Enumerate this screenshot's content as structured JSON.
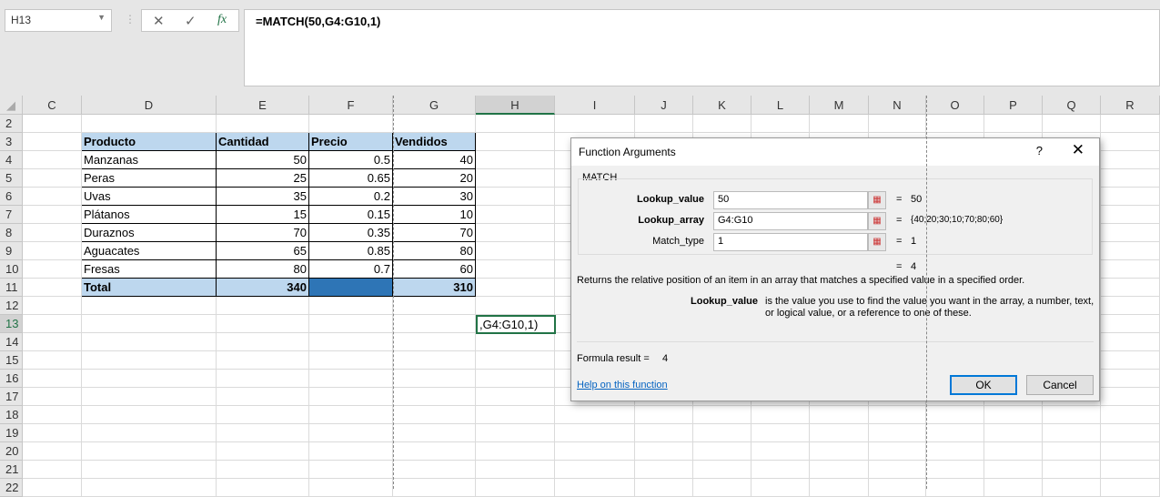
{
  "name_box": "H13",
  "formula_bar": {
    "cancel_icon": "✕",
    "enter_icon": "✓",
    "fx_icon": "fx",
    "formula": "=MATCH(50,G4:G10,1)"
  },
  "columns": [
    "C",
    "D",
    "E",
    "F",
    "G",
    "H",
    "I",
    "J",
    "K",
    "L",
    "M",
    "N",
    "O",
    "P",
    "Q",
    "R"
  ],
  "rows": [
    "2",
    "3",
    "4",
    "5",
    "6",
    "7",
    "8",
    "9",
    "10",
    "11",
    "12",
    "13",
    "14",
    "15",
    "16",
    "17",
    "18",
    "19",
    "20",
    "21",
    "22"
  ],
  "table": {
    "headers": [
      "Producto",
      "Cantidad",
      "Precio",
      "Vendidos"
    ],
    "rows": [
      [
        "Manzanas",
        "50",
        "0.5",
        "40"
      ],
      [
        "Peras",
        "25",
        "0.65",
        "20"
      ],
      [
        "Uvas",
        "35",
        "0.2",
        "30"
      ],
      [
        "Plátanos",
        "15",
        "0.15",
        "10"
      ],
      [
        "Duraznos",
        "70",
        "0.35",
        "70"
      ],
      [
        "Aguacates",
        "65",
        "0.85",
        "80"
      ],
      [
        "Fresas",
        "80",
        "0.7",
        "60"
      ]
    ],
    "total": [
      "Total",
      "340",
      "",
      "310"
    ]
  },
  "active_cell_text": ",G4:G10,1)",
  "colors": {
    "header_fill": "#bdd7ee",
    "total_fill": "#bdd7ee",
    "dark_fill": "#2e75b6",
    "accent": "#217346"
  },
  "dialog": {
    "title": "Function Arguments",
    "help_icon": "?",
    "close_icon": "✕",
    "function_name": "MATCH",
    "args": [
      {
        "label": "Lookup_value",
        "value": "50",
        "result": "50"
      },
      {
        "label": "Lookup_array",
        "value": "G4:G10",
        "result": "{40;20;30;10;70;80;60}"
      },
      {
        "label": "Match_type",
        "value": "1",
        "result": "1"
      }
    ],
    "eq": "=",
    "overall_result": "4",
    "description": "Returns the relative position of an item in an array that matches a specified value in a specified order.",
    "arg_help_name": "Lookup_value",
    "arg_help_text": "is the value you use to find the value you want in the array, a number, text, or logical value, or a reference to one of these.",
    "formula_result_label": "Formula result =",
    "formula_result": "4",
    "help_link": "Help on this function",
    "ok": "OK",
    "cancel": "Cancel"
  }
}
